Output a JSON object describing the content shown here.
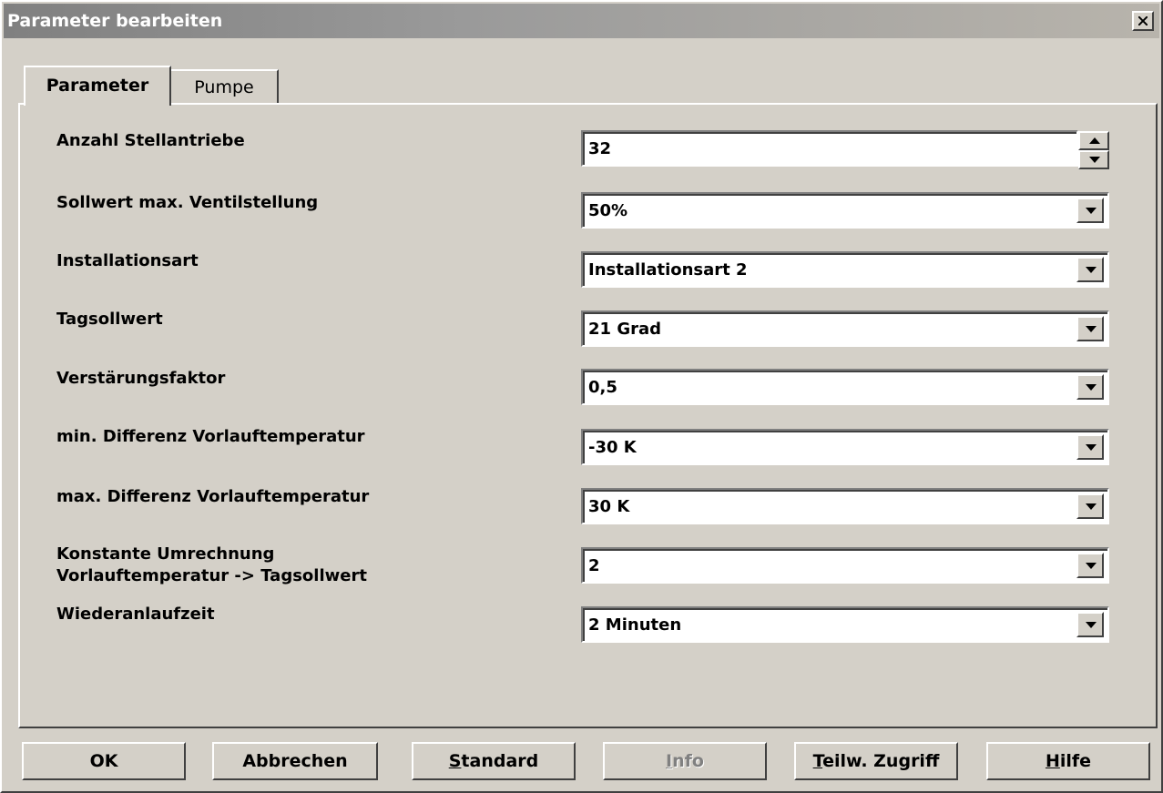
{
  "window": {
    "title": "Parameter bearbeiten",
    "close_icon": "close-icon"
  },
  "tabs": [
    {
      "label": "Parameter"
    },
    {
      "label": "Pumpe"
    }
  ],
  "params": [
    {
      "label": "Anzahl Stellantriebe",
      "value": "32",
      "control": "spinner"
    },
    {
      "label": "Sollwert max. Ventilstellung",
      "value": "50%",
      "control": "dropdown"
    },
    {
      "label": "Installationsart",
      "value": "Installationsart 2",
      "control": "dropdown"
    },
    {
      "label": "Tagsollwert",
      "value": "21 Grad",
      "control": "dropdown"
    },
    {
      "label": "Verstärungsfaktor",
      "value": "0,5",
      "control": "dropdown"
    },
    {
      "label": "min. Differenz Vorlauftemperatur",
      "value": "-30 K",
      "control": "dropdown"
    },
    {
      "label": "max. Differenz Vorlauftemperatur",
      "value": "30 K",
      "control": "dropdown"
    },
    {
      "label_line1": "Konstante Umrechnung",
      "label_line2": "Vorlauftemperatur -> Tagsollwert",
      "value": "2",
      "control": "dropdown"
    },
    {
      "label": "Wiederanlaufzeit",
      "value": "2 Minuten",
      "control": "dropdown"
    }
  ],
  "buttons": {
    "ok": "OK",
    "cancel": "Abbrechen",
    "standard_mn": "S",
    "standard_rest": "tandard",
    "info_mn": "I",
    "info_rest": "nfo",
    "teilw_mn": "T",
    "teilw_rest": "eilw. Zugriff",
    "hilfe_mn": "H",
    "hilfe_rest": "ilfe"
  }
}
